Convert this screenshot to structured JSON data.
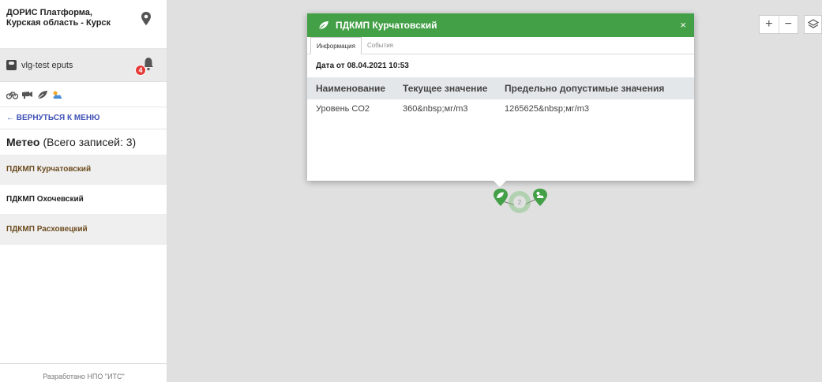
{
  "sidebar": {
    "location": "ДОРИС Платформа, Курская область - Курск",
    "user": "vlg-test eputs",
    "notification_count": "4",
    "back_label": "← ВЕРНУТЬСЯ К МЕНЮ",
    "section_title": "Метео",
    "section_count": "(Всего записей: 3)",
    "items": [
      {
        "label": "ПДКМП Курчатовский"
      },
      {
        "label": "ПДКМП Охочевский"
      },
      {
        "label": "ПДКМП Расховецкий"
      }
    ],
    "footer": "Разработано НПО \"ИТС\""
  },
  "popup": {
    "title": "ПДКМП Курчатовский",
    "close": "×",
    "tabs": [
      "Информация",
      "События"
    ],
    "date_line": "Дата от 08.04.2021 10:53",
    "columns": [
      "Наименование",
      "Текущее значение",
      "Предельно допустимые значения"
    ],
    "rows": [
      {
        "name": "Уровень CO2",
        "current": "360&nbsp;мг/m3",
        "limit": "1265625&nbsp;мг/m3"
      }
    ]
  },
  "map": {
    "cluster_count": "2",
    "zoom_in": "+",
    "zoom_out": "−"
  },
  "colors": {
    "header_green": "#43a047",
    "marker_green": "#43a047",
    "link_blue": "#3f51b5",
    "badge_red": "#e53935"
  }
}
